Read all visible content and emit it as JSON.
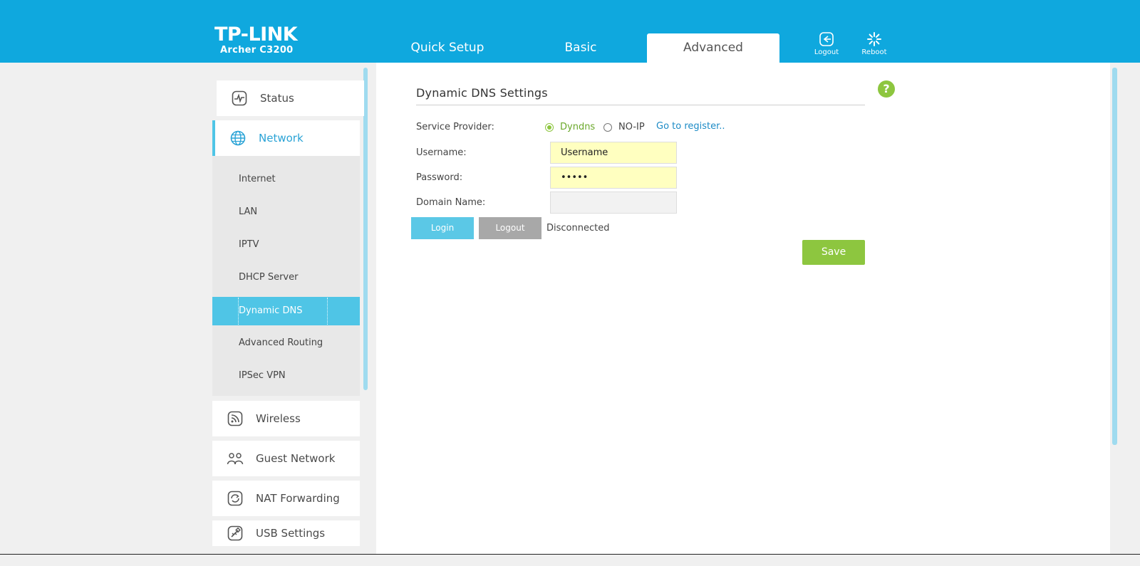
{
  "brand": {
    "logo": "TP-LINK",
    "model": "Archer C3200"
  },
  "tabs": [
    {
      "label": "Quick Setup"
    },
    {
      "label": "Basic"
    },
    {
      "label": "Advanced"
    }
  ],
  "header_buttons": {
    "logout": "Logout",
    "reboot": "Reboot"
  },
  "sidebar": {
    "items": [
      {
        "label": "Status",
        "icon": "status-icon"
      },
      {
        "label": "Network",
        "icon": "globe-icon"
      },
      {
        "label": "Wireless",
        "icon": "wireless-icon"
      },
      {
        "label": "Guest Network",
        "icon": "guest-network-icon"
      },
      {
        "label": "NAT Forwarding",
        "icon": "nat-forwarding-icon"
      },
      {
        "label": "USB Settings",
        "icon": "usb-icon"
      }
    ],
    "network_sub": [
      {
        "label": "Internet"
      },
      {
        "label": "LAN"
      },
      {
        "label": "IPTV"
      },
      {
        "label": "DHCP Server"
      },
      {
        "label": "Dynamic DNS"
      },
      {
        "label": "Advanced Routing"
      },
      {
        "label": "IPSec VPN"
      }
    ]
  },
  "ddns": {
    "title": "Dynamic DNS Settings",
    "service_provider_label": "Service Provider:",
    "provider_dyndns": "Dyndns",
    "provider_noip": "NO-IP",
    "selected_provider": "Dyndns",
    "register_link": "Go to register..",
    "username_label": "Username:",
    "username_value": "Username",
    "password_label": "Password:",
    "password_value": "•••••",
    "domain_label": "Domain Name:",
    "domain_value": "",
    "login_button": "Login",
    "logout_button": "Logout",
    "status": "Disconnected",
    "save_button": "Save",
    "help": "?"
  },
  "colors": {
    "header": "#0fa8de",
    "accent": "#4fc5e6",
    "save_green": "#8dc63f",
    "login_blue": "#5bc8e6",
    "logout_gray": "#a8a8a8",
    "input_yellow": "#ffffc0"
  }
}
